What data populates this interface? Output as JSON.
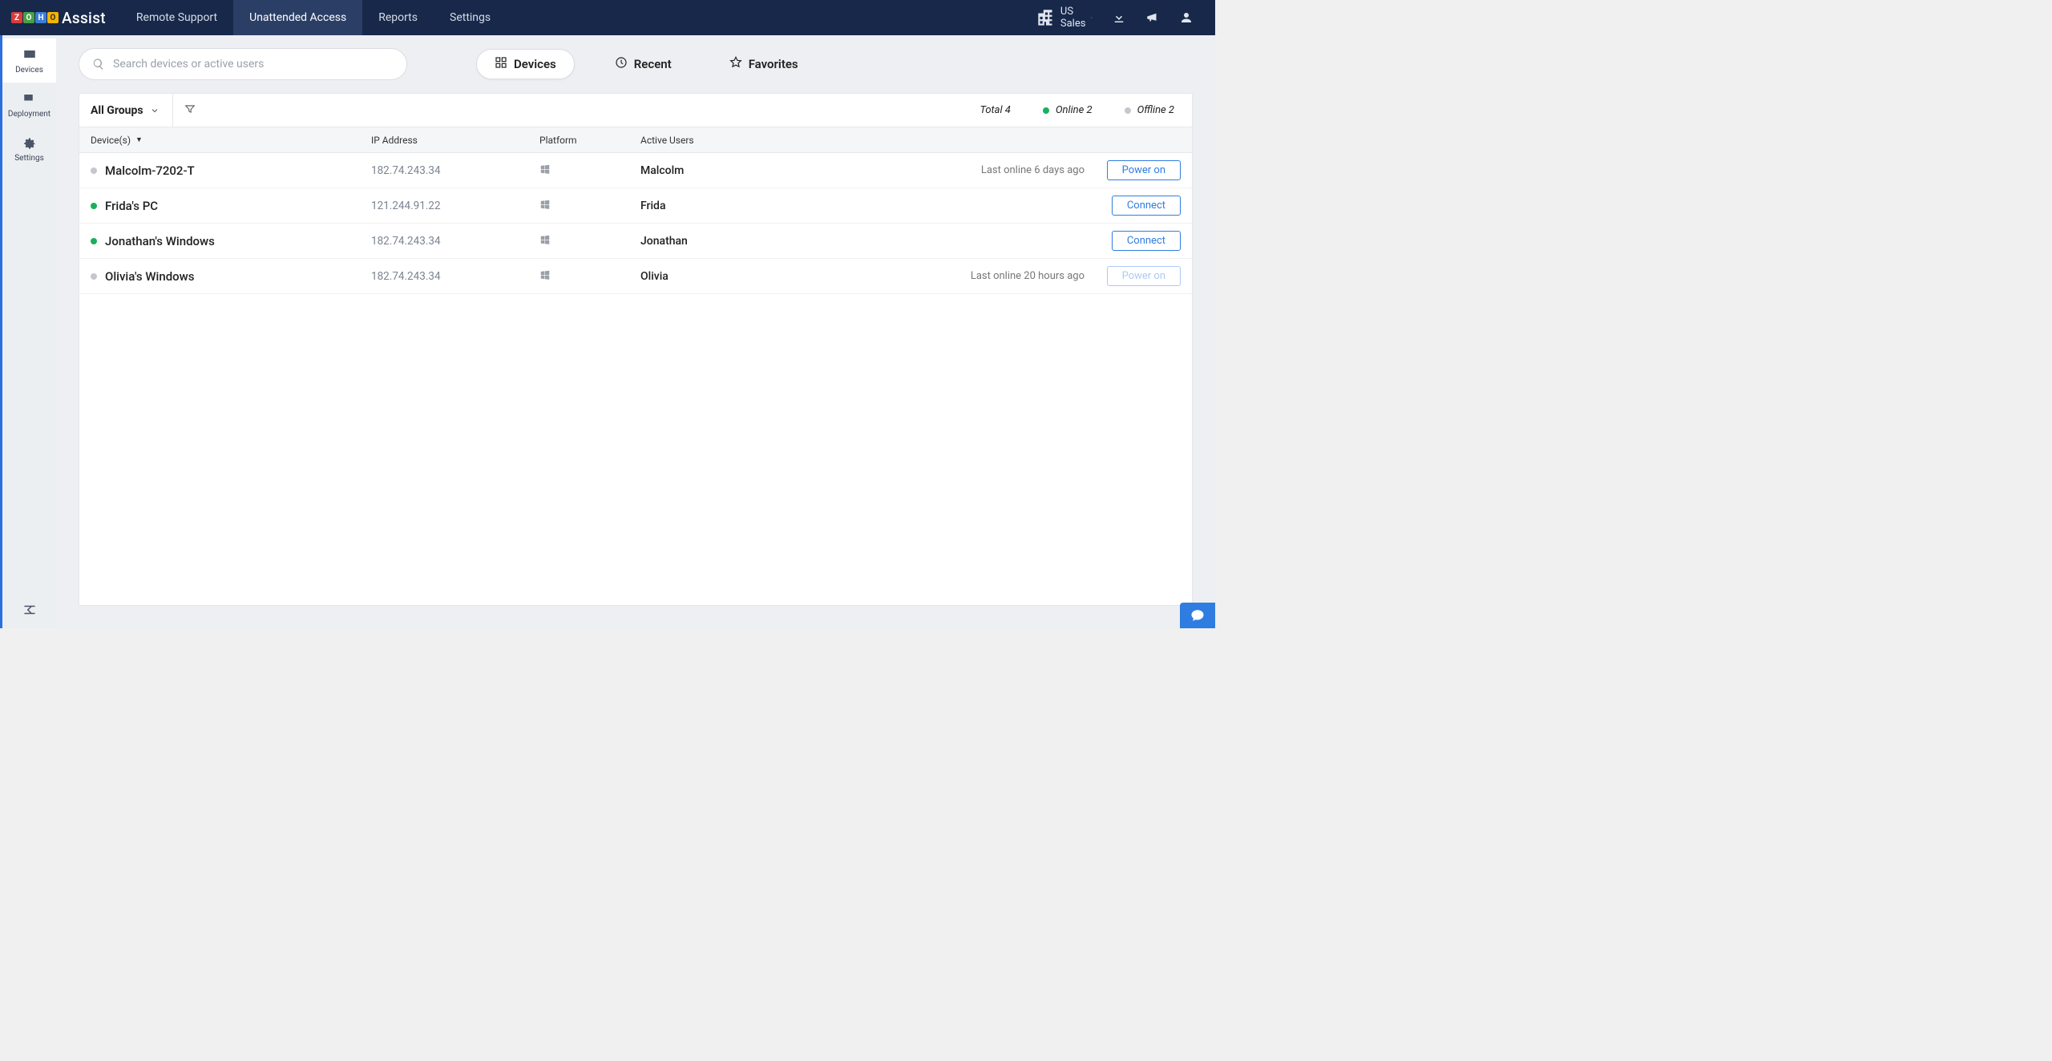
{
  "brand": {
    "assist": "Assist",
    "z": "Z",
    "o1": "O",
    "h": "H",
    "o2": "O"
  },
  "topnav": {
    "items": [
      "Remote Support",
      "Unattended Access",
      "Reports",
      "Settings"
    ],
    "active_index": 1,
    "org": "US Sales"
  },
  "sidebar": {
    "items": [
      {
        "label": "Devices",
        "icon": "monitor"
      },
      {
        "label": "Deployment",
        "icon": "monitor-plus"
      },
      {
        "label": "Settings",
        "icon": "gear"
      }
    ],
    "active_index": 0
  },
  "search": {
    "placeholder": "Search devices or active users"
  },
  "tabs": {
    "items": [
      "Devices",
      "Recent",
      "Favorites"
    ],
    "active_index": 0
  },
  "filter": {
    "group_label": "All Groups",
    "total_label": "Total 4",
    "online_label": "Online 2",
    "offline_label": "Offline 2"
  },
  "table": {
    "headers": {
      "device": "Device(s)",
      "ip": "IP Address",
      "platform": "Platform",
      "user": "Active Users"
    },
    "rows": [
      {
        "online": false,
        "name": "Malcolm-7202-T",
        "ip": "182.74.243.34",
        "platform": "windows",
        "user": "Malcolm",
        "status": "Last online 6 days ago",
        "action": "Power on",
        "disabled": false
      },
      {
        "online": true,
        "name": "Frida's PC",
        "ip": "121.244.91.22",
        "platform": "windows",
        "user": "Frida",
        "status": "",
        "action": "Connect",
        "disabled": false
      },
      {
        "online": true,
        "name": "Jonathan's Windows",
        "ip": "182.74.243.34",
        "platform": "windows",
        "user": "Jonathan",
        "status": "",
        "action": "Connect",
        "disabled": false
      },
      {
        "online": false,
        "name": "Olivia's Windows",
        "ip": "182.74.243.34",
        "platform": "windows",
        "user": "Olivia",
        "status": "Last online 20 hours ago",
        "action": "Power on",
        "disabled": true
      }
    ]
  }
}
